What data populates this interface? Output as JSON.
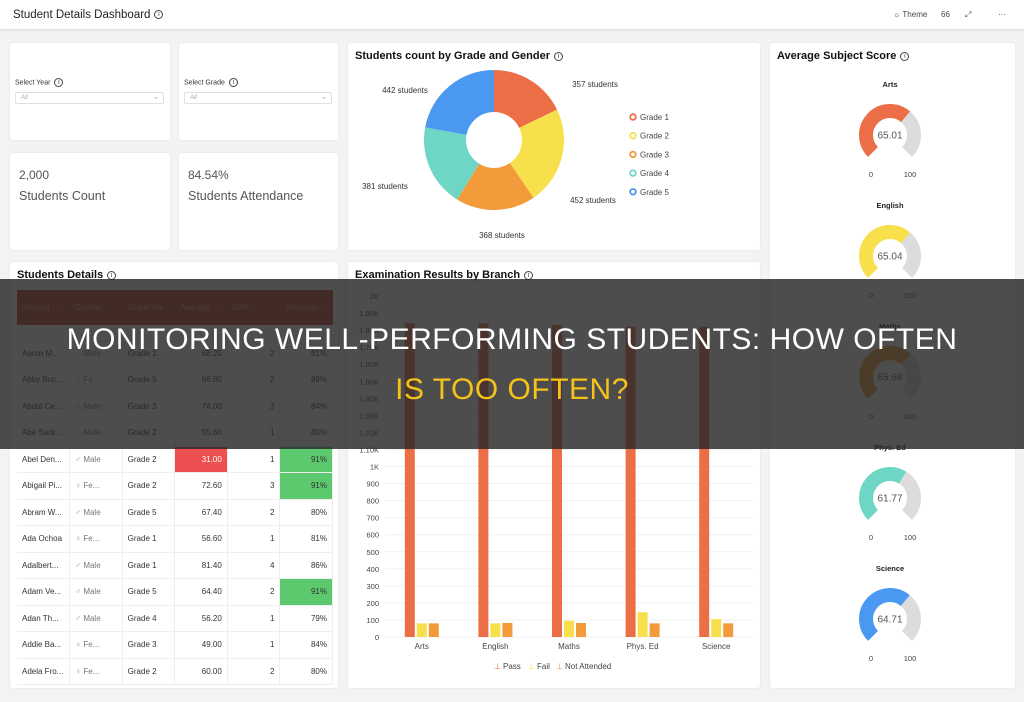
{
  "header": {
    "title": "Student Details Dashboard",
    "theme_label": "Theme",
    "view_label": "66",
    "expand_icon": "expand-icon",
    "more_icon": "more-icon"
  },
  "filters": [
    {
      "label": "Select Year",
      "value": "All"
    },
    {
      "label": "Select Grade",
      "value": "All"
    }
  ],
  "kpis": [
    {
      "value": "2,000",
      "label": "Students Count"
    },
    {
      "value": "84.54%",
      "label": "Students Attendance"
    }
  ],
  "donut": {
    "title": "Students count by Grade and Gender",
    "chart_data": {
      "type": "pie",
      "categories": [
        "Grade 1",
        "Grade 2",
        "Grade 3",
        "Grade 4",
        "Grade 5"
      ],
      "values": [
        357,
        452,
        368,
        381,
        442
      ],
      "data_labels": [
        "357 students",
        "452 students",
        "368 students",
        "381 students",
        "442 students"
      ],
      "colors": [
        "#ec6e47",
        "#f7e04b",
        "#f39a3a",
        "#6ed6c4",
        "#4a98f0"
      ],
      "legend": "right",
      "inner_radius_ratio": 0.4
    }
  },
  "table": {
    "title": "Students Details",
    "columns": [
      "Student ...",
      "Gender",
      "Grade Na...",
      "Average ...",
      "GPA",
      "Attendan..."
    ],
    "rows": [
      [
        "Aaron M...",
        "Male",
        "Grade 1",
        "68.20",
        "2",
        "81%"
      ],
      [
        "Abby Buc...",
        "Fe...",
        "Grade 5",
        "66.80",
        "2",
        "89%"
      ],
      [
        "Abdul Ce...",
        "Male",
        "Grade 3",
        "74.00",
        "3",
        "84%"
      ],
      [
        "Abe Sant...",
        "Male",
        "Grade 2",
        "55.60",
        "1",
        "80%"
      ],
      [
        "Abel Den...",
        "Male",
        "Grade 2",
        "31.00",
        "1",
        "91%"
      ],
      [
        "Abigail Pi...",
        "Fe...",
        "Grade 2",
        "72.60",
        "3",
        "91%"
      ],
      [
        "Abram W...",
        "Male",
        "Grade 5",
        "67.40",
        "2",
        "80%"
      ],
      [
        "Ada Ochoa",
        "Fe...",
        "Grade 1",
        "56.60",
        "1",
        "81%"
      ],
      [
        "Adalbert...",
        "Male",
        "Grade 1",
        "81.40",
        "4",
        "86%"
      ],
      [
        "Adam Ve...",
        "Male",
        "Grade 5",
        "64.40",
        "2",
        "91%"
      ],
      [
        "Adan Th...",
        "Male",
        "Grade 4",
        "56.20",
        "1",
        "79%"
      ],
      [
        "Addie Ba...",
        "Fe...",
        "Grade 3",
        "49.00",
        "1",
        "84%"
      ],
      [
        "Adela Fro...",
        "Fe...",
        "Grade 2",
        "60.00",
        "2",
        "80%"
      ]
    ],
    "highlight_low_score_color": "#ec5050",
    "highlight_attendance_color": "#5cc96e"
  },
  "exam": {
    "title": "Examination Results by Branch",
    "chart_data": {
      "type": "bar",
      "categories": [
        "Arts",
        "English",
        "Maths",
        "Phys. Ed",
        "Science"
      ],
      "series": [
        {
          "name": "Pass",
          "values": [
            1840,
            1840,
            1830,
            1820,
            1820
          ],
          "color": "#ec6e47"
        },
        {
          "name": "Fail",
          "values": [
            80,
            80,
            95,
            145,
            105
          ],
          "color": "#f7e04b"
        },
        {
          "name": "Not Attended",
          "values": [
            80,
            82,
            82,
            80,
            80
          ],
          "color": "#f39a3a"
        }
      ],
      "ylim": [
        0,
        2000
      ],
      "yticks": [
        "0",
        "100",
        "200",
        "300",
        "400",
        "500",
        "600",
        "700",
        "800",
        "900",
        "1K",
        "1.10K",
        "1.20K",
        "1.30K",
        "1.40K",
        "1.50K",
        "1.60K",
        "1.70K",
        "1.80K",
        "1.90K",
        "2K"
      ],
      "grid": true,
      "legend": "bottom"
    }
  },
  "gauges": {
    "title": "Average Subject Score",
    "min_label": "0",
    "max_label": "100",
    "items": [
      {
        "name": "Arts",
        "value": 65.01,
        "label": "65.01",
        "color": "#ec6e47"
      },
      {
        "name": "English",
        "value": 65.04,
        "label": "65.04",
        "color": "#f7e04b"
      },
      {
        "name": "Maths",
        "value": 65.68,
        "label": "65.68",
        "color": "#f39a3a"
      },
      {
        "name": "Phys. Ed",
        "value": 61.77,
        "label": "61.77",
        "color": "#6ed6c4"
      },
      {
        "name": "Science",
        "value": 64.71,
        "label": "64.71",
        "color": "#4a98f0"
      }
    ]
  },
  "overlay": {
    "line1": "MONITORING WELL-PERFORMING STUDENTS: HOW OFTEN",
    "line2": "IS TOO OFTEN?"
  }
}
